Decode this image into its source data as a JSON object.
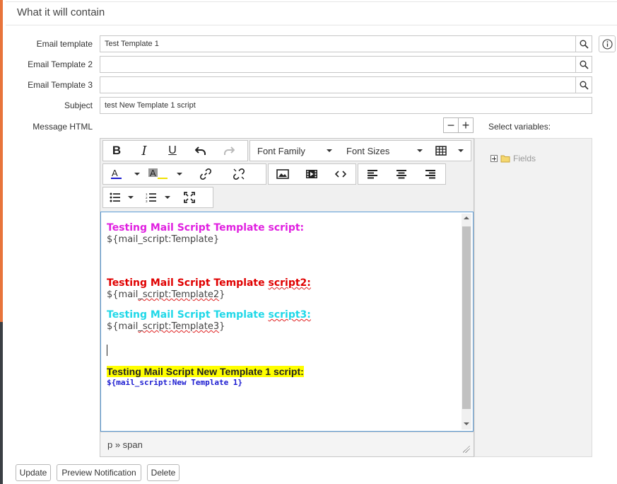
{
  "section": {
    "title": "What it will contain"
  },
  "form": {
    "email_template_label": "Email template",
    "email_template_value": "Test Template 1",
    "email_template2_label": "Email Template 2",
    "email_template2_value": "",
    "email_template3_label": "Email Template 3",
    "email_template3_value": "",
    "subject_label": "Subject",
    "subject_value": "test New Template 1 script",
    "message_html_label": "Message HTML"
  },
  "toolbar": {
    "font_family": "Font Family",
    "font_sizes": "Font Sizes"
  },
  "content": {
    "line1_heading": "Testing Mail Script Template script:",
    "line1_code": "${mail_script:Template}",
    "line2_heading_prefix": "Testing Mail Script Template ",
    "line2_heading_word": "script2:",
    "line2_code_prefix": "${mail",
    "line2_code_word": "_script:Template2",
    "line2_code_suffix": "}",
    "line3_heading_prefix": "Testing Mail Script Template ",
    "line3_heading_word": "script3:",
    "line3_code_prefix": "${mail",
    "line3_code_word": "_script:Template3",
    "line3_code_suffix": "}",
    "line4_heading": "Testing Mail Script New Template 1 script:",
    "line4_code": "${mail_script:New Template 1}"
  },
  "statusbar": {
    "path": "p » span"
  },
  "variables": {
    "label": "Select variables:",
    "fields_node": "Fields"
  },
  "actions": {
    "update": "Update",
    "preview": "Preview Notification",
    "delete": "Delete"
  },
  "colors": {
    "accent": "#e8743b",
    "heading_magenta": "#e020e0",
    "heading_red": "#e00000",
    "heading_cyan": "#20d8e8",
    "highlight_yellow": "#ffff00",
    "code_blue": "#1a1ad0"
  }
}
